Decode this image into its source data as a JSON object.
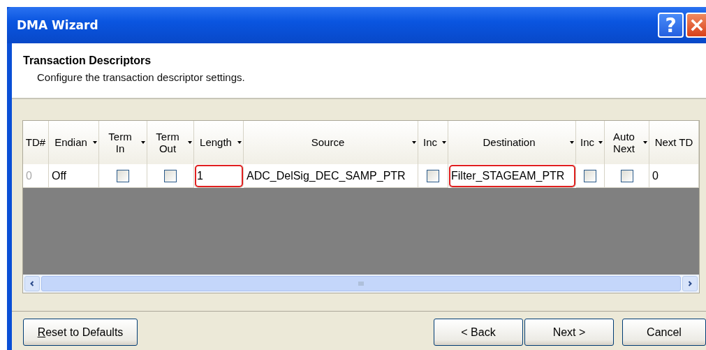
{
  "window": {
    "title": "DMA Wizard",
    "help_button": "?"
  },
  "header": {
    "title": "Transaction Descriptors",
    "subtitle": "Configure the transaction descriptor settings."
  },
  "table": {
    "columns": [
      {
        "label": "TD#",
        "filter": false
      },
      {
        "label": "Endian",
        "filter": true
      },
      {
        "label": "Term\nIn",
        "filter": true
      },
      {
        "label": "Term\nOut",
        "filter": true
      },
      {
        "label": "Length",
        "filter": true
      },
      {
        "label": "Source",
        "filter": true
      },
      {
        "label": "Inc",
        "filter": true
      },
      {
        "label": "Destination",
        "filter": true
      },
      {
        "label": "Inc",
        "filter": true
      },
      {
        "label": "Auto\nNext",
        "filter": true
      },
      {
        "label": "Next TD",
        "filter": false
      }
    ],
    "rows": [
      {
        "cells": [
          {
            "kind": "index",
            "text": "0"
          },
          {
            "kind": "text",
            "text": "Off",
            "highlighted": false
          },
          {
            "kind": "checkbox",
            "checked": false
          },
          {
            "kind": "checkbox",
            "checked": false
          },
          {
            "kind": "text",
            "text": "1",
            "highlighted": true
          },
          {
            "kind": "text",
            "text": "ADC_DelSig_DEC_SAMP_PTR",
            "highlighted": false
          },
          {
            "kind": "checkbox",
            "checked": false
          },
          {
            "kind": "text",
            "text": "Filter_STAGEAM_PTR",
            "highlighted": true
          },
          {
            "kind": "checkbox",
            "checked": false
          },
          {
            "kind": "checkbox",
            "checked": false
          },
          {
            "kind": "text",
            "text": "0",
            "highlighted": false
          }
        ]
      }
    ]
  },
  "buttons": [
    {
      "label": "Reset to Defaults",
      "underline_first": true
    },
    {
      "label": "< Back",
      "underline_first": false
    },
    {
      "label": "Next >",
      "underline_first": false
    },
    {
      "label": "Cancel",
      "underline_first": false
    }
  ]
}
